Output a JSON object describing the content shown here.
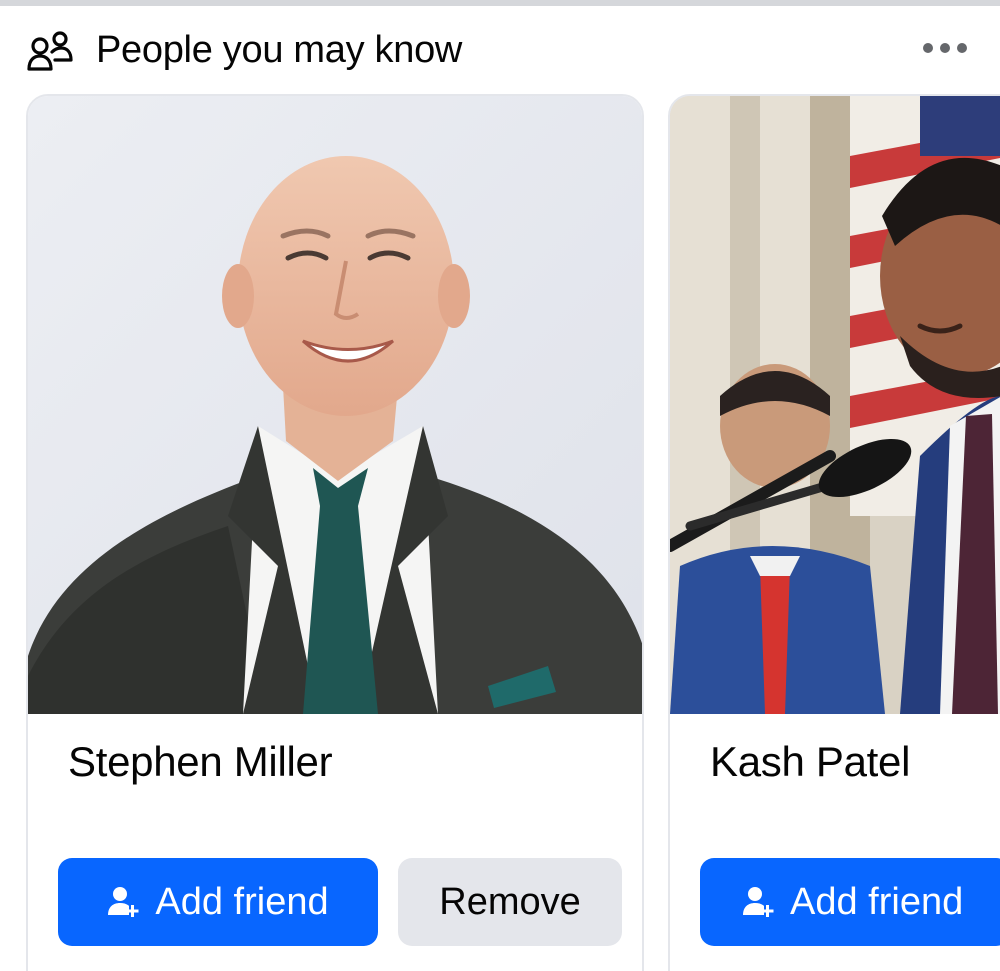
{
  "header": {
    "title": "People you may know",
    "icon": "people-icon",
    "more_icon": "more-horizontal-icon"
  },
  "suggestions": [
    {
      "name": "Stephen Miller",
      "add_label": "Add friend",
      "remove_label": "Remove",
      "add_icon": "add-person-icon"
    },
    {
      "name": "Kash Patel",
      "add_label": "Add friend",
      "add_icon": "add-person-icon"
    }
  ],
  "colors": {
    "primary_button": "#0866ff",
    "secondary_button": "#e4e6eb",
    "text": "#050505",
    "divider": "#d5d7db"
  }
}
